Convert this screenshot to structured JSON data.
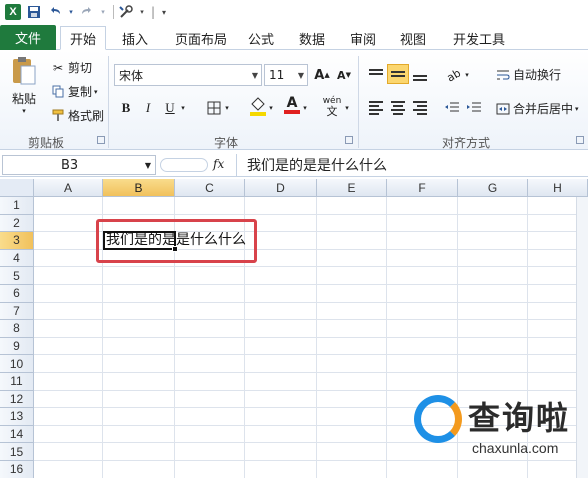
{
  "window": {
    "qat_separator": "|"
  },
  "tabs": [
    {
      "label": "文件"
    },
    {
      "label": "开始"
    },
    {
      "label": "插入"
    },
    {
      "label": "页面布局"
    },
    {
      "label": "公式"
    },
    {
      "label": "数据"
    },
    {
      "label": "审阅"
    },
    {
      "label": "视图"
    },
    {
      "label": "开发工具"
    }
  ],
  "ribbon": {
    "clipboard": {
      "paste": "粘贴",
      "cut": "剪切",
      "copy": "复制",
      "format_painter": "格式刷",
      "group_label": "剪贴板"
    },
    "font": {
      "font_name": "宋体",
      "font_size": "11",
      "grow": "A",
      "shrink": "A",
      "bold": "B",
      "italic": "I",
      "underline": "U",
      "wen": "wén",
      "group_label": "字体",
      "font_color": "#e02020",
      "fill_color": "#f5d800"
    },
    "alignment": {
      "wrap_text": "自动换行",
      "merge_center": "合并后居中",
      "group_label": "对齐方式"
    }
  },
  "formula_bar": {
    "name_box": "B3",
    "fx": "fx",
    "content": "我们是的是是什么什么"
  },
  "grid": {
    "columns": [
      "A",
      "B",
      "C",
      "D",
      "E",
      "F",
      "G",
      "H"
    ],
    "selected_column": "B",
    "rows": [
      "1",
      "2",
      "3",
      "4",
      "5",
      "6",
      "7",
      "8",
      "9",
      "10",
      "11",
      "12",
      "13",
      "14",
      "15",
      "16"
    ],
    "selected_row": "3",
    "cell_b3": "我们是的是是什么什么"
  },
  "watermark": {
    "text": "查询啦",
    "url": "chaxunla.com"
  },
  "colors": {
    "file_tab": "#1f7a3d",
    "highlight": "#d8434b",
    "selected_header": "#f1c15c"
  }
}
